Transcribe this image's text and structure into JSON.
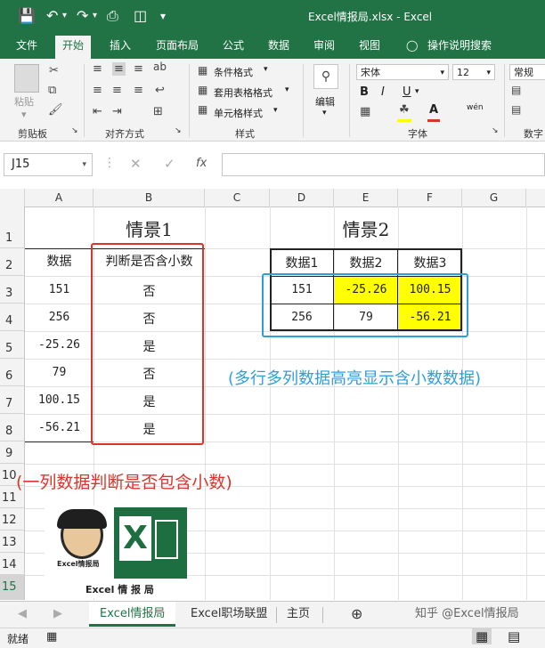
{
  "window": {
    "title": "Excel情报局.xlsx  -  Excel"
  },
  "ribbon_tabs": [
    "文件",
    "开始",
    "插入",
    "页面布局",
    "公式",
    "数据",
    "审阅",
    "视图",
    "操作说明搜索"
  ],
  "active_tab": "开始",
  "ribbon": {
    "paste_label": "粘贴",
    "clipboard_group": "剪贴板",
    "alignment_group": "对齐方式",
    "cond_format": "条件格式",
    "table_format": "套用表格格式",
    "cell_style": "单元格样式",
    "styles_group": "样式",
    "edit_label": "编辑",
    "font_name": "宋体",
    "font_size": "12",
    "font_group": "字体",
    "number_format": "常规",
    "number_group": "数字",
    "bold": "B",
    "italic": "I",
    "underline": "U",
    "wen": "wén"
  },
  "formula_bar": {
    "name_box": "J15",
    "fx": "fx",
    "formula": ""
  },
  "columns": [
    "A",
    "B",
    "C",
    "D",
    "E",
    "F",
    "G"
  ],
  "rows": [
    "1",
    "2",
    "3",
    "4",
    "5",
    "6",
    "7",
    "8",
    "9",
    "10",
    "11",
    "12",
    "13",
    "14",
    "15"
  ],
  "scene1": {
    "title": "情景1",
    "header_a": "数据",
    "header_b": "判断是否含小数",
    "data": [
      {
        "value": "151",
        "result": "否"
      },
      {
        "value": "256",
        "result": "否"
      },
      {
        "value": "-25.26",
        "result": "是"
      },
      {
        "value": "79",
        "result": "否"
      },
      {
        "value": "100.15",
        "result": "是"
      },
      {
        "value": "-56.21",
        "result": "是"
      }
    ],
    "annotation": "(一列数据判断是否包含小数)"
  },
  "scene2": {
    "title": "情景2",
    "headers": [
      "数据1",
      "数据2",
      "数据3"
    ],
    "rows": [
      [
        "151",
        "-25.26",
        "100.15"
      ],
      [
        "256",
        "79",
        "-56.21"
      ]
    ],
    "annotation": "(多行多列数据高亮显示含小数数据)"
  },
  "logo": {
    "label1": "Excel情报局",
    "label2": "Excel 情 报 局"
  },
  "sheet_tabs": [
    "Excel情报局",
    "Excel职场联盟",
    "主页"
  ],
  "active_sheet": "Excel情报局",
  "watermark": "知乎 @Excel情报局",
  "status": "就绪",
  "colors": {
    "excel_green": "#217346",
    "highlight": "#ffff00",
    "red_box": "#d9362b",
    "blue_box": "#2f9fd8"
  }
}
